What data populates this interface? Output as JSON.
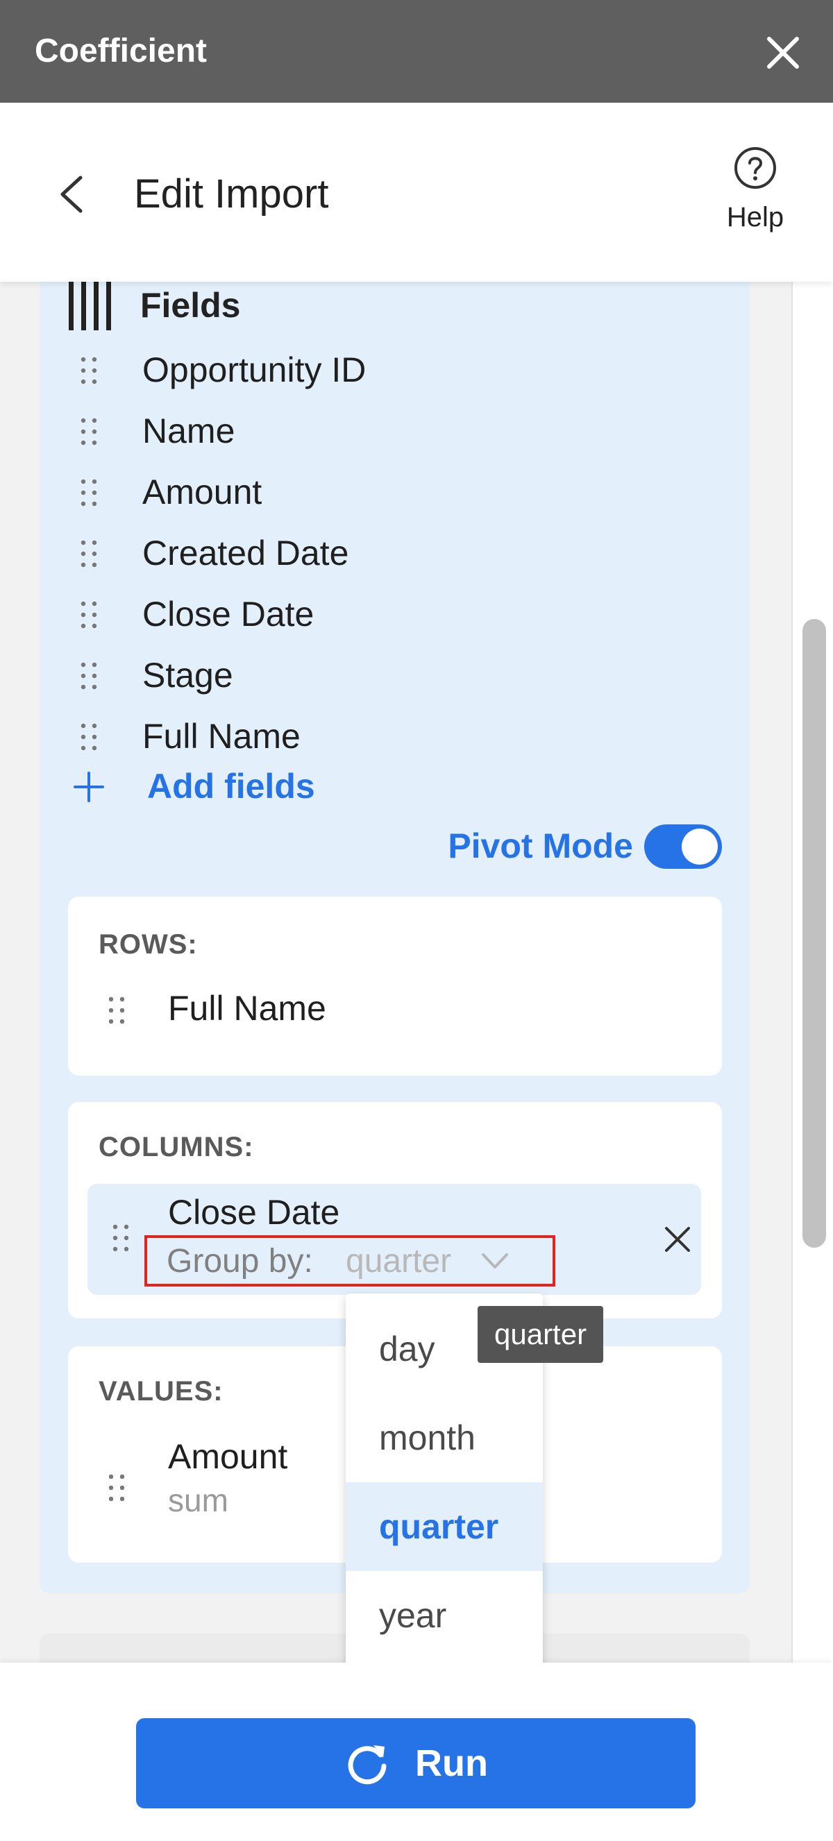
{
  "window": {
    "app_title": "Coefficient",
    "close_icon": "close-icon"
  },
  "header": {
    "back_icon": "chevron-left-icon",
    "title": "Edit Import",
    "help_icon": "question-circle-icon",
    "help_label": "Help"
  },
  "fields": {
    "heading": "Fields",
    "heading_icon": "columns-icon",
    "items": [
      "Opportunity ID",
      "Name",
      "Amount",
      "Created Date",
      "Close Date",
      "Stage",
      "Full Name"
    ],
    "add_label": "Add fields"
  },
  "pivot": {
    "label": "Pivot Mode",
    "enabled": true
  },
  "rows": {
    "heading": "ROWS:",
    "items": [
      "Full Name"
    ]
  },
  "columns": {
    "heading": "COLUMNS:",
    "item": {
      "name": "Close Date",
      "group_by_label": "Group by:",
      "group_by_value": "quarter"
    }
  },
  "values": {
    "heading": "VALUES:",
    "item": {
      "name": "Amount",
      "aggregation": "sum"
    }
  },
  "dropdown": {
    "options": [
      "day",
      "month",
      "quarter",
      "year"
    ],
    "selected": "quarter"
  },
  "tooltip": {
    "text": "quarter"
  },
  "footer": {
    "run_label": "Run",
    "run_icon": "refresh-icon"
  },
  "colors": {
    "accent": "#2673e8",
    "titlebar": "#5f5f5f",
    "panel": "#e3f0fb",
    "highlight_border": "#e0261c"
  }
}
